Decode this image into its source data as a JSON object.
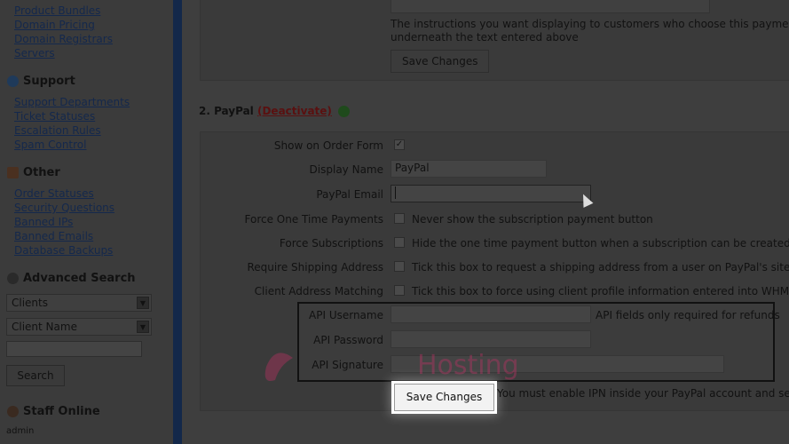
{
  "sidebar": {
    "setup_links": [
      "Product Bundles",
      "Domain Pricing",
      "Domain Registrars",
      "Servers"
    ],
    "support": {
      "heading": "Support",
      "links": [
        "Support Departments",
        "Ticket Statuses",
        "Escalation Rules",
        "Spam Control"
      ]
    },
    "other": {
      "heading": "Other",
      "links": [
        "Order Statuses",
        "Security Questions",
        "Banned IPs",
        "Banned Emails",
        "Database Backups"
      ]
    },
    "advanced_search": {
      "heading": "Advanced Search",
      "select1": "Clients",
      "select2": "Client Name",
      "search_button": "Search"
    },
    "staff_online": {
      "heading": "Staff Online",
      "user": "admin"
    }
  },
  "main": {
    "top_panel": {
      "instructions_line1": "The instructions you want displaying to customers who choose this payment met",
      "instructions_line2": "underneath the text entered above",
      "save_button": "Save Changes"
    },
    "paypal": {
      "title": "2. PayPal",
      "deactivate": "(Deactivate)",
      "rows": {
        "show_on_order_form": "Show on Order Form",
        "display_name_label": "Display Name",
        "display_name_value": "PayPal",
        "paypal_email_label": "PayPal Email",
        "force_one_time_label": "Force One Time Payments",
        "force_one_time_desc": "Never show the subscription payment button",
        "force_subscriptions_label": "Force Subscriptions",
        "force_subscriptions_desc": "Hide the one time payment button when a subscription can be created",
        "require_shipping_label": "Require Shipping Address",
        "require_shipping_desc": "Tick this box to request a shipping address from a user on PayPal's site",
        "client_address_label": "Client Address Matching",
        "client_address_desc": "Tick this box to force using client profile information entered into WHMCS at",
        "api_username_label": "API Username",
        "api_note": "API fields only required for refunds",
        "api_password_label": "API Password",
        "api_signature_label": "API Signature"
      },
      "save_button": "Save Changes",
      "ipn_note": "You must enable IPN inside your PayPal account and set the"
    }
  },
  "watermark_text": "Hosting",
  "colors": {
    "link": "#14284c",
    "deactivate": "#5a1010",
    "sidebar_border": "#13284a"
  }
}
